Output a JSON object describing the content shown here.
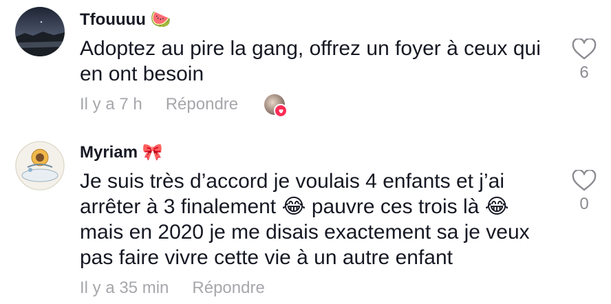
{
  "comments": [
    {
      "username": "Tfouuuu 🍉",
      "text": "Adoptez au pire la gang, offrez un foyer à ceux qui en ont besoin",
      "time": "Il y a 7 h",
      "reply_label": "Répondre",
      "like_count": "6",
      "liked_by_creator": true
    },
    {
      "username": "Myriam 🎀",
      "text": "Je suis très d’accord je voulais 4 enfants et j’ai arrêter à 3 finalement 😂 pauvre ces trois là 😂mais en 2020 je me disais exactement sa je veux pas faire vivre cette vie à un autre enfant",
      "time": "Il y a 35 min",
      "reply_label": "Répondre",
      "like_count": "0",
      "liked_by_creator": false
    }
  ],
  "colors": {
    "primary_text": "#161823",
    "secondary_text": "#a6a7ab",
    "like_outline": "#8a8b91",
    "accent_heart": "#fe2c55"
  },
  "icons": {
    "like": "heart-outline-icon",
    "creator_like": "heart-badge-icon"
  }
}
